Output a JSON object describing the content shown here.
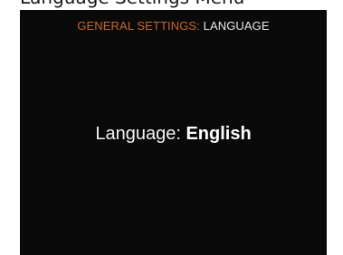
{
  "caption": "Language Settings Menu",
  "header": {
    "section": "GENERAL SETTINGS:",
    "page": "LANGUAGE"
  },
  "setting": {
    "label": "Language:",
    "value": "English"
  },
  "colors": {
    "screen_background": "#0a0a0a",
    "header_section": "#c8692a",
    "header_page": "#e8e8e8",
    "text": "#f2f2f2"
  }
}
